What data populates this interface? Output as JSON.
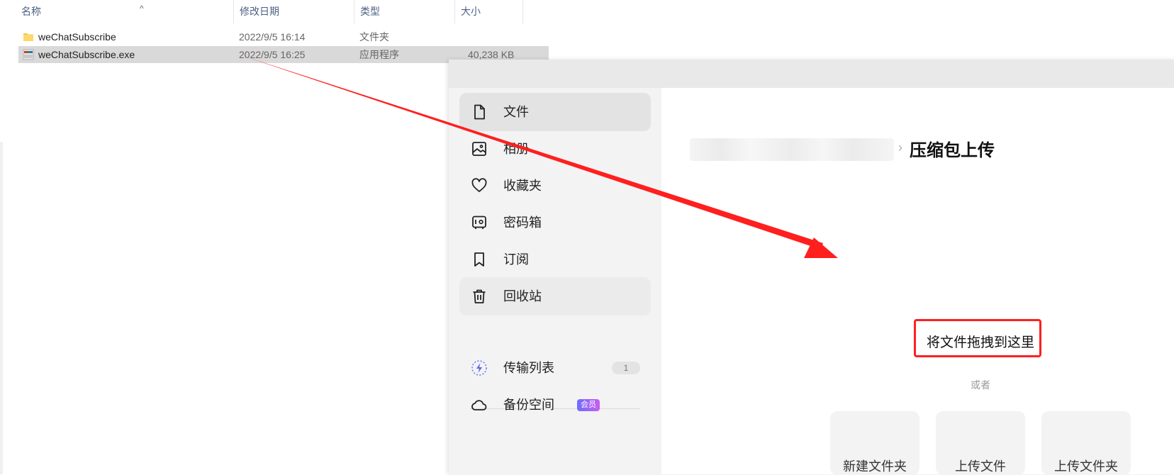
{
  "explorer": {
    "columns": {
      "name": "名称",
      "modified": "修改日期",
      "type": "类型",
      "size": "大小"
    },
    "files": [
      {
        "name": "weChatSubscribe",
        "modified": "2022/9/5 16:14",
        "type": "文件夹",
        "size": ""
      },
      {
        "name": "weChatSubscribe.exe",
        "modified": "2022/9/5 16:25",
        "type": "应用程序",
        "size": "40,238 KB"
      }
    ]
  },
  "cloud": {
    "sidebar": {
      "items": [
        {
          "label": "文件",
          "icon": "file-icon"
        },
        {
          "label": "相册",
          "icon": "photo-album-icon"
        },
        {
          "label": "收藏夹",
          "icon": "heart-icon"
        },
        {
          "label": "密码箱",
          "icon": "safe-box-icon"
        },
        {
          "label": "订阅",
          "icon": "bookmark-icon"
        },
        {
          "label": "回收站",
          "icon": "trash-icon"
        }
      ],
      "transfer": {
        "label": "传输列表",
        "count": "1",
        "icon": "lightning-icon"
      },
      "backup": {
        "label": "备份空间",
        "badge": "会员",
        "icon": "cloud-icon"
      }
    },
    "main": {
      "breadcrumb_current": "压缩包上传",
      "breadcrumb_sep": "›",
      "drop_hint": "将文件拖拽到这里",
      "or": "或者",
      "actions": [
        "新建文件夹",
        "上传文件",
        "上传文件夹"
      ]
    }
  },
  "colors": {
    "annotation": "#ff1f1f",
    "vip_start": "#6f6cff",
    "vip_end": "#c85ef0"
  }
}
